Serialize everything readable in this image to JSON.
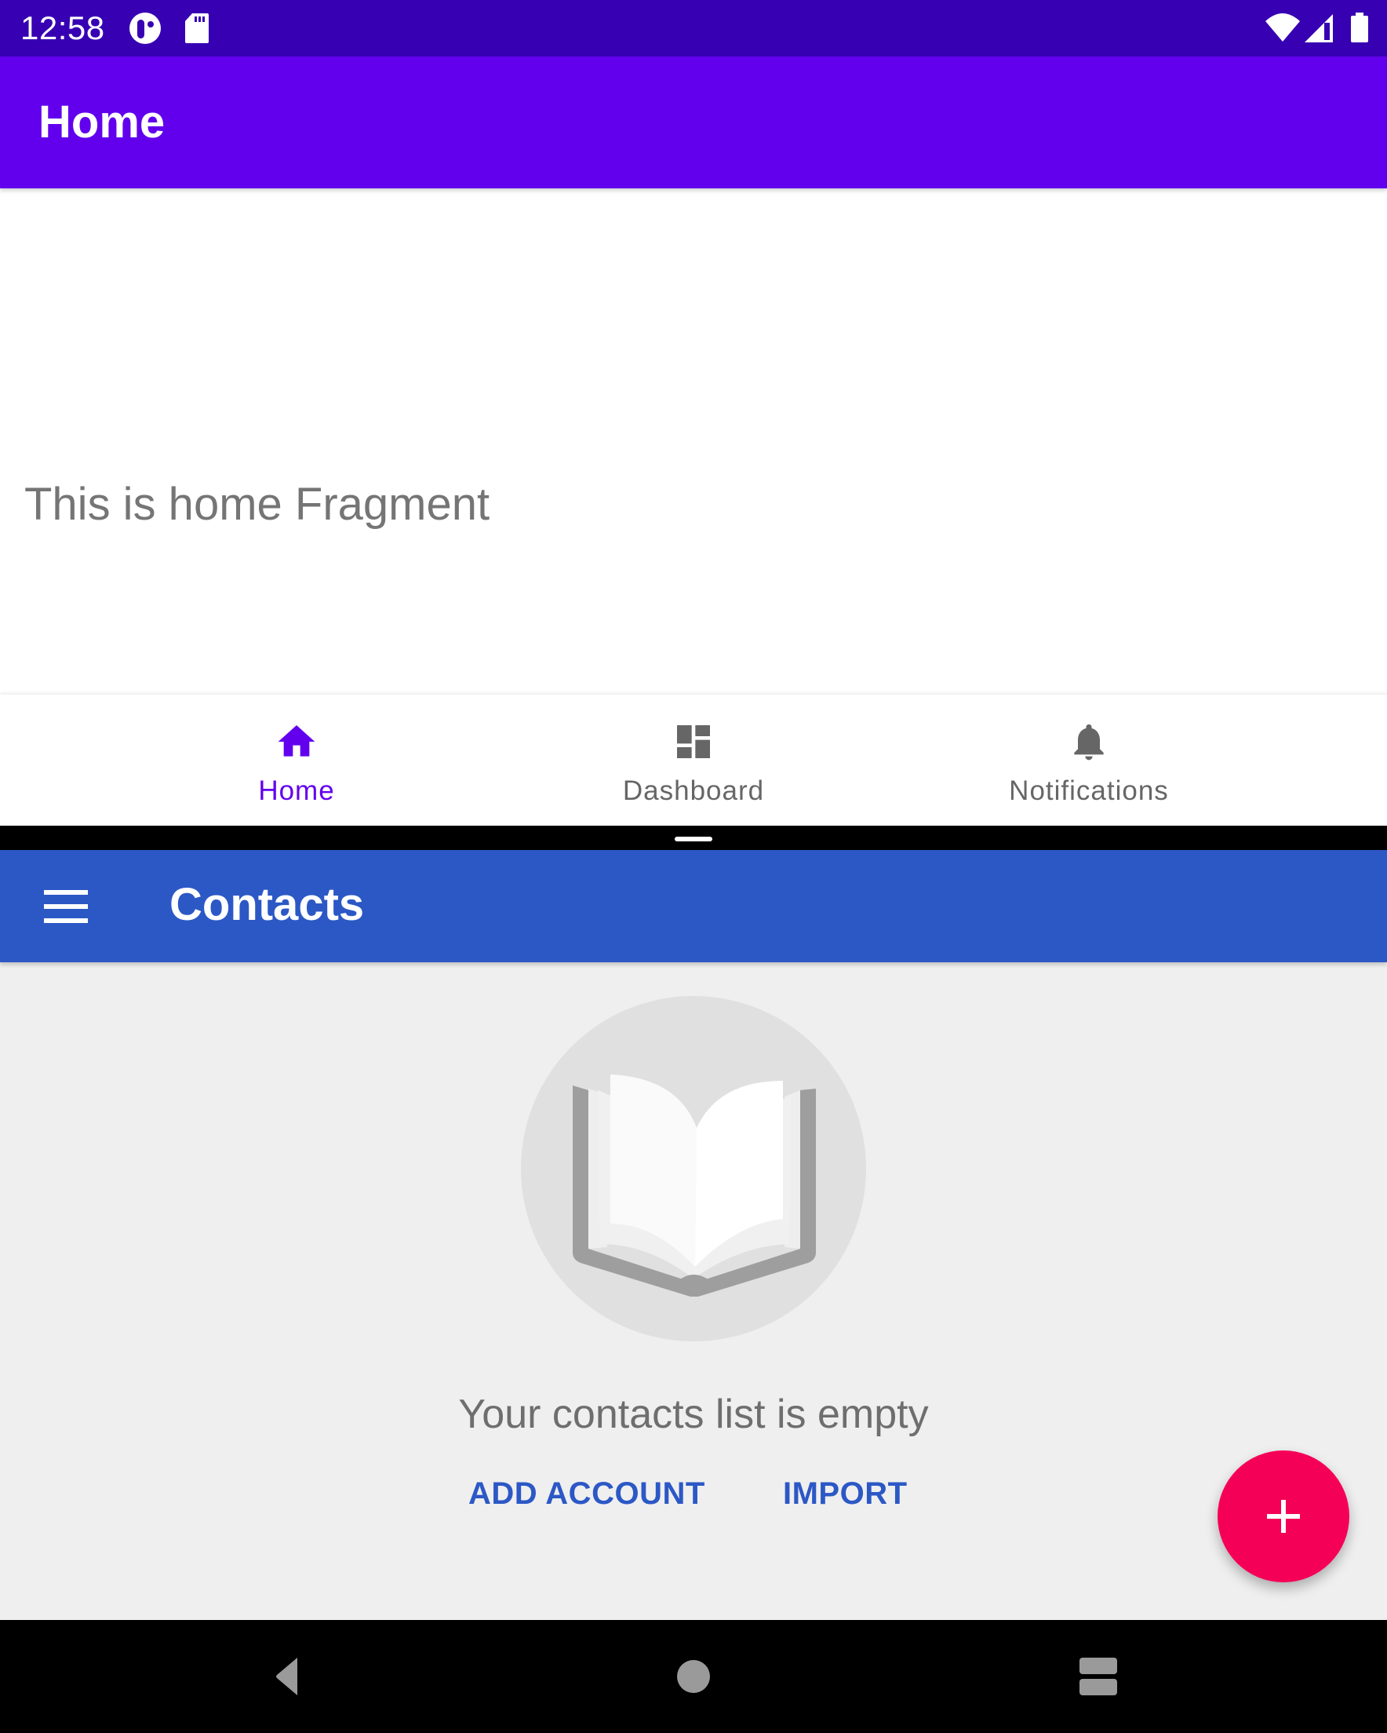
{
  "status_bar": {
    "time": "12:58",
    "left_icons": [
      "app-notification-icon",
      "sd-card-icon"
    ],
    "right_icons": [
      "wifi-icon",
      "cell-signal-icon",
      "battery-icon"
    ]
  },
  "top_app": {
    "title": "Home",
    "content_text": "This is home Fragment",
    "bottom_nav": [
      {
        "label": "Home",
        "icon": "home-icon",
        "active": true
      },
      {
        "label": "Dashboard",
        "icon": "dashboard-icon",
        "active": false
      },
      {
        "label": "Notifications",
        "icon": "bell-icon",
        "active": false
      }
    ],
    "colors": {
      "primary": "#6200ee",
      "status": "#3700b3",
      "inactive": "#666666",
      "text": "#757575"
    }
  },
  "bottom_app": {
    "title": "Contacts",
    "empty_message": "Your contacts list is empty",
    "actions": {
      "add_account": "ADD ACCOUNT",
      "import": "IMPORT"
    },
    "fab_icon": "plus-icon",
    "colors": {
      "primary": "#2c58c6",
      "fab": "#f50057",
      "background": "#efefef"
    }
  },
  "nav_bar": {
    "buttons": [
      "back-icon",
      "home-circle-icon",
      "recents-icon"
    ]
  }
}
